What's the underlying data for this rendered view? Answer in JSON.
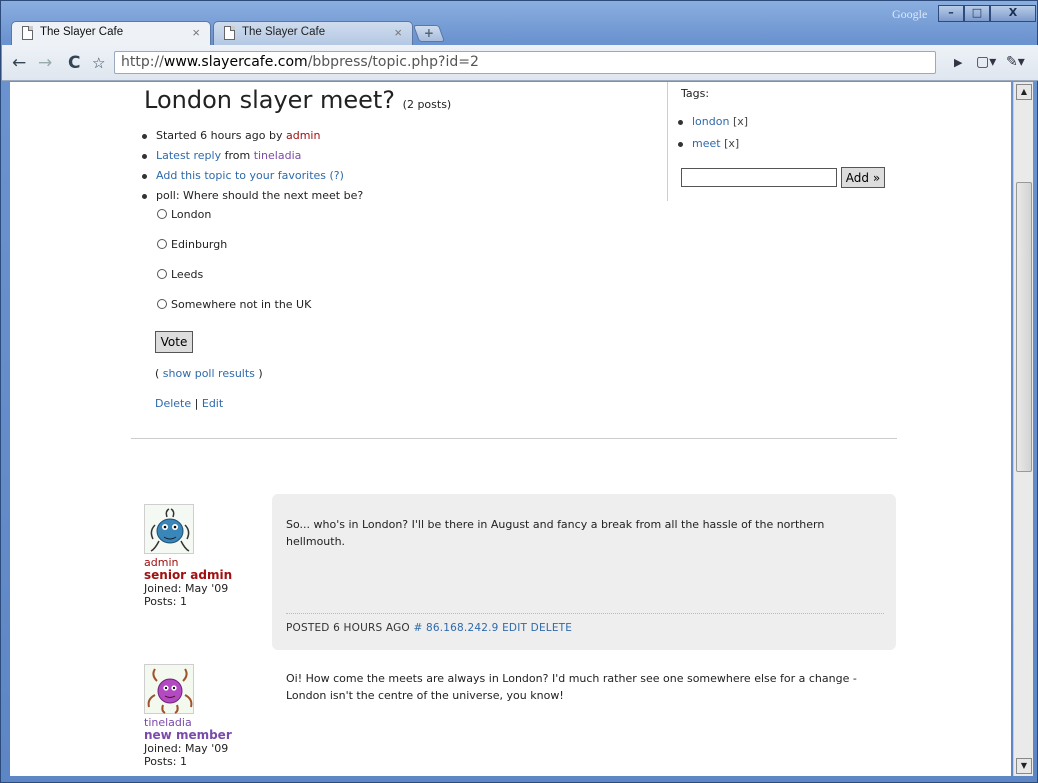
{
  "browser": {
    "tabs": [
      {
        "label": "The Slayer Cafe",
        "active": true
      },
      {
        "label": "The Slayer Cafe",
        "active": false
      }
    ],
    "new_tab_glyph": "+",
    "google_label": "Google",
    "window_buttons": {
      "minimize": "–",
      "maximize": "□",
      "close": "X"
    },
    "url_prefix": "http://",
    "url_host": "www.slayercafe.com",
    "url_path": "/bbpress/topic.php?id=2",
    "icons": [
      "back-icon",
      "forward-icon",
      "reload-icon",
      "star-icon",
      "page-menu-icon",
      "wrench-icon"
    ]
  },
  "topic": {
    "title": "London slayer meet?",
    "post_count": "(2 posts)",
    "started_text": "Started 6 hours ago by ",
    "started_by": "admin",
    "latest_reply_link": "Latest reply",
    "latest_reply_from": " from ",
    "latest_reply_user": "tineladia",
    "favorites_link": "Add this topic to your favorites",
    "favorites_help": "(?)",
    "poll_question": "poll: Where should the next meet be?",
    "poll_options": [
      "London",
      "Edinburgh",
      "Leeds",
      "Somewhere not in the UK"
    ],
    "vote_label": "Vote",
    "show_results_open": "( ",
    "show_results_link": "show poll results",
    "show_results_close": " )",
    "delete_link": "Delete",
    "edit_link": "Edit",
    "separator": "|"
  },
  "tags": {
    "title": "Tags:",
    "items": [
      {
        "name": "london",
        "remove": "[x]"
      },
      {
        "name": "meet",
        "remove": "[x]"
      }
    ],
    "input_value": "",
    "add_label": "Add »"
  },
  "posts": [
    {
      "username": "admin",
      "role": "senior admin",
      "joined": "Joined: May '09",
      "posts": "Posts: 1",
      "text": "So... who's in London? I'll be there in August and fancy a break from all the hassle of the northern hellmouth.",
      "posted": "POSTED 6 HOURS AGO",
      "ip": "# 86.168.242.9",
      "edit": "EDIT",
      "delete": "DELETE"
    },
    {
      "username": "tineladia",
      "role": "new member",
      "joined": "Joined: May '09",
      "posts": "Posts: 1",
      "text": "Oi! How come the meets are always in London? I'd much rather see one somewhere else for a change - London isn't the centre of the universe, you know!"
    }
  ],
  "colors": {
    "link": "#2e6aab",
    "admin_red": "#a01010",
    "member_purple": "#7a4ba8",
    "post_bg": "#eeeeee"
  }
}
